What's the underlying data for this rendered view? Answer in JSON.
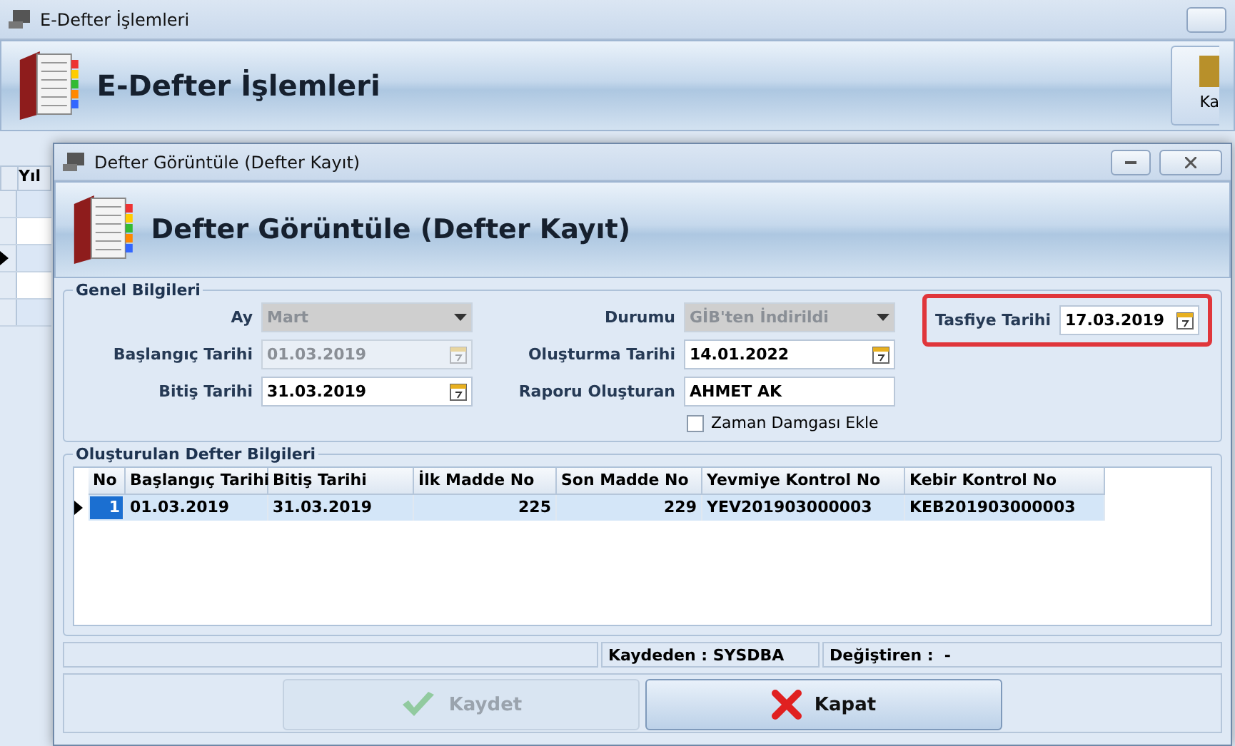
{
  "main_window": {
    "title": "E-Defter İşlemleri",
    "header": "E-Defter İşlemleri",
    "toolbar_button": "Ka",
    "grid": {
      "columns": [
        "Yıl"
      ],
      "rows": [
        {
          "current": false
        },
        {
          "current": false
        },
        {
          "current": true
        },
        {
          "current": false
        },
        {
          "current": false
        }
      ]
    }
  },
  "dialog": {
    "title": "Defter Görüntüle (Defter Kayıt)",
    "header": "Defter Görüntüle (Defter Kayıt)",
    "general": {
      "title": "Genel Bilgileri",
      "columns": [
        [
          {
            "kind": "dropdown",
            "label": "Ay",
            "value": "Mart",
            "disabled": true
          },
          {
            "kind": "date",
            "label": "Başlangıç Tarihi",
            "value": "01.03.2019",
            "disabled": true
          },
          {
            "kind": "date",
            "label": "Bitiş Tarihi",
            "value": "31.03.2019",
            "disabled": false
          }
        ],
        [
          {
            "kind": "dropdown",
            "label": "Durumu",
            "value": "GİB'ten İndirildi",
            "disabled": true
          },
          {
            "kind": "date",
            "label": "Oluşturma Tarihi",
            "value": "14.01.2022",
            "disabled": false
          },
          {
            "kind": "text",
            "label": "Raporu Oluşturan",
            "value": "AHMET AK",
            "disabled": false
          },
          {
            "kind": "checkbox",
            "label": "Zaman Damgası Ekle",
            "checked": false
          }
        ],
        [
          {
            "kind": "date",
            "label": "Tasfiye Tarihi",
            "value": "17.03.2019",
            "disabled": false,
            "highlighted": true
          }
        ]
      ]
    },
    "table": {
      "title": "Oluşturulan Defter Bilgileri",
      "columns": [
        "No",
        "Başlangıç Tarihi",
        "Bitiş Tarihi",
        "İlk Madde No",
        "Son Madde No",
        "Yevmiye Kontrol No",
        "Kebir Kontrol No"
      ],
      "rows": [
        {
          "selected": true,
          "cells": [
            "1",
            "01.03.2019",
            "31.03.2019",
            "225",
            "229",
            "YEV201903000003",
            "KEB201903000003"
          ]
        }
      ]
    },
    "status_bar": [
      "Kaydeden : SYSDBA",
      "Değiştiren :  -"
    ],
    "buttons": [
      {
        "kind": "save",
        "label": "Kaydet",
        "disabled": true
      },
      {
        "kind": "close",
        "label": "Kapat",
        "disabled": false
      }
    ]
  }
}
